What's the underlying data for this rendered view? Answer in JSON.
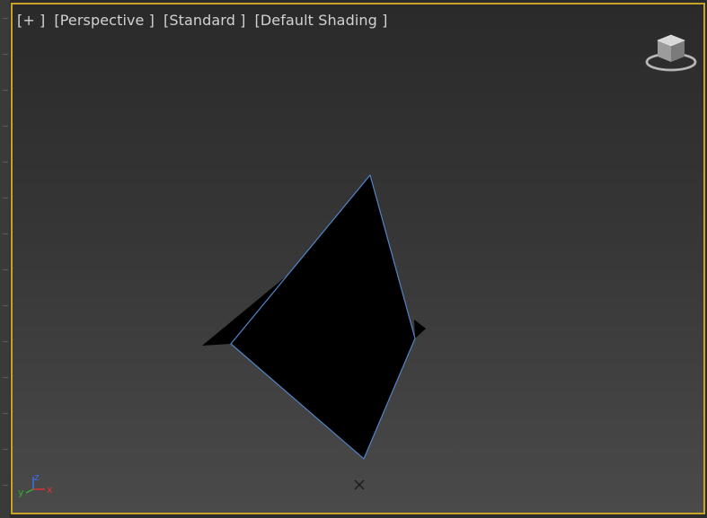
{
  "viewport": {
    "labels": {
      "menu": "[+ ]",
      "view": "[Perspective ]",
      "camera": "[Standard ]",
      "shading": "[Default Shading ]"
    },
    "active_border_color": "#c9a227"
  },
  "widgets": {
    "viewcube_icon": "viewcube-icon",
    "axis_tripod": {
      "x_label": "x",
      "y_label": "y",
      "z_label": "z",
      "x_color": "#e03030",
      "y_color": "#30b030",
      "z_color": "#3a6fe8"
    },
    "pivot_icon": "close-x-icon"
  },
  "colors": {
    "object_fill": "#000000",
    "edge_highlight": "#4f86c9"
  }
}
